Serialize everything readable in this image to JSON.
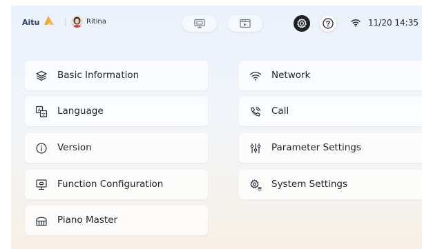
{
  "header": {
    "brand": "Aitu",
    "user_name": "Ritina",
    "mode_icons": [
      "presentation-icon",
      "video-board-icon"
    ],
    "settings_icon": "gear-icon",
    "help_icon": "help-icon",
    "wifi_icon": "wifi-icon",
    "clock": "11/20 14:35"
  },
  "settings_menu": {
    "left": [
      {
        "label": "Basic Information",
        "icon": "layers-icon"
      },
      {
        "label": "Language",
        "icon": "translate-icon"
      },
      {
        "label": "Version",
        "icon": "info-icon"
      },
      {
        "label": "Function Configuration",
        "icon": "monitor-icon"
      },
      {
        "label": "Piano Master",
        "icon": "piano-icon"
      }
    ],
    "right": [
      {
        "label": "Network",
        "icon": "wifi-icon"
      },
      {
        "label": "Call",
        "icon": "phone-call-icon"
      },
      {
        "label": "Parameter Settings",
        "icon": "sliders-icon"
      },
      {
        "label": "System Settings",
        "icon": "system-gear-icon"
      }
    ]
  },
  "colors": {
    "brand_text": "#2a3b66",
    "brand_accent": "#f5a623",
    "active_button": "#1f2024"
  }
}
